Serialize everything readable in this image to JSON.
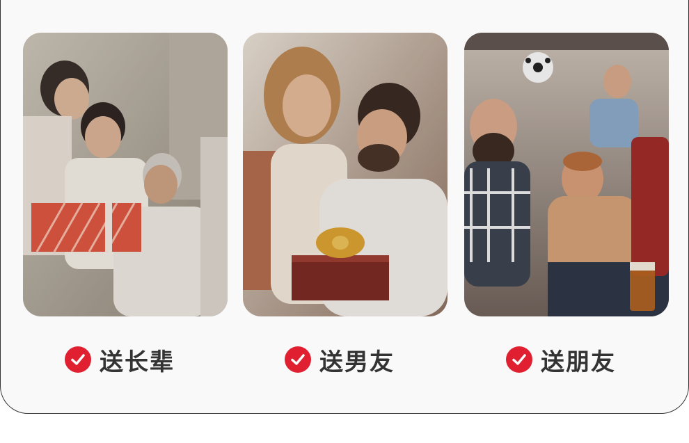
{
  "cards": [
    {
      "label": "送长辈",
      "photo": "family-elder-gift-photo",
      "accent": "#d9563f"
    },
    {
      "label": "送男友",
      "photo": "couple-gift-photo",
      "accent": "#8a2e22"
    },
    {
      "label": "送朋友",
      "photo": "friends-cheering-photo",
      "accent": "#c8643a"
    }
  ],
  "icon": "check-circle-icon",
  "colors": {
    "check": "#e02030",
    "text": "#333333",
    "panel": "#f9f9f9"
  }
}
